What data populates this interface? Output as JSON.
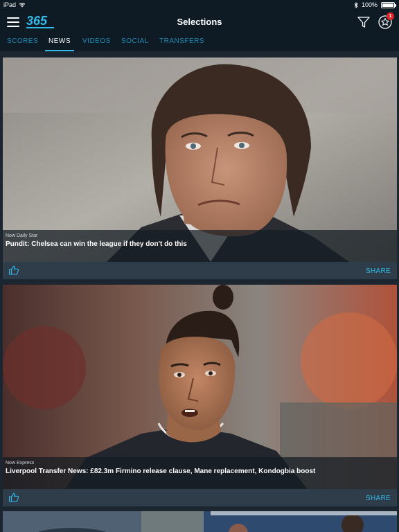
{
  "status": {
    "device": "iPad",
    "battery": "100%",
    "battery_level": 1.0
  },
  "header": {
    "title": "Selections",
    "logo_text": "365",
    "notification_count": "1"
  },
  "tabs": [
    {
      "label": "SCORES"
    },
    {
      "label": "NEWS"
    },
    {
      "label": "VIDEOS"
    },
    {
      "label": "SOCIAL"
    },
    {
      "label": "TRANSFERS"
    }
  ],
  "active_tab": "NEWS",
  "articles": [
    {
      "source": "Now Daily Star",
      "headline": "Pundit: Chelsea can win the league if they don't do this",
      "share_label": "SHARE"
    },
    {
      "source": "Now Express",
      "headline": "Liverpool Transfer News: £82.3m Firmino release clause, Mane replacement, Kondogbia boost",
      "share_label": "SHARE"
    }
  ],
  "colors": {
    "accent": "#31b9ea",
    "header_bg": "#0e1a24",
    "feed_bg": "#1b2630",
    "badge": "#e0262b"
  }
}
